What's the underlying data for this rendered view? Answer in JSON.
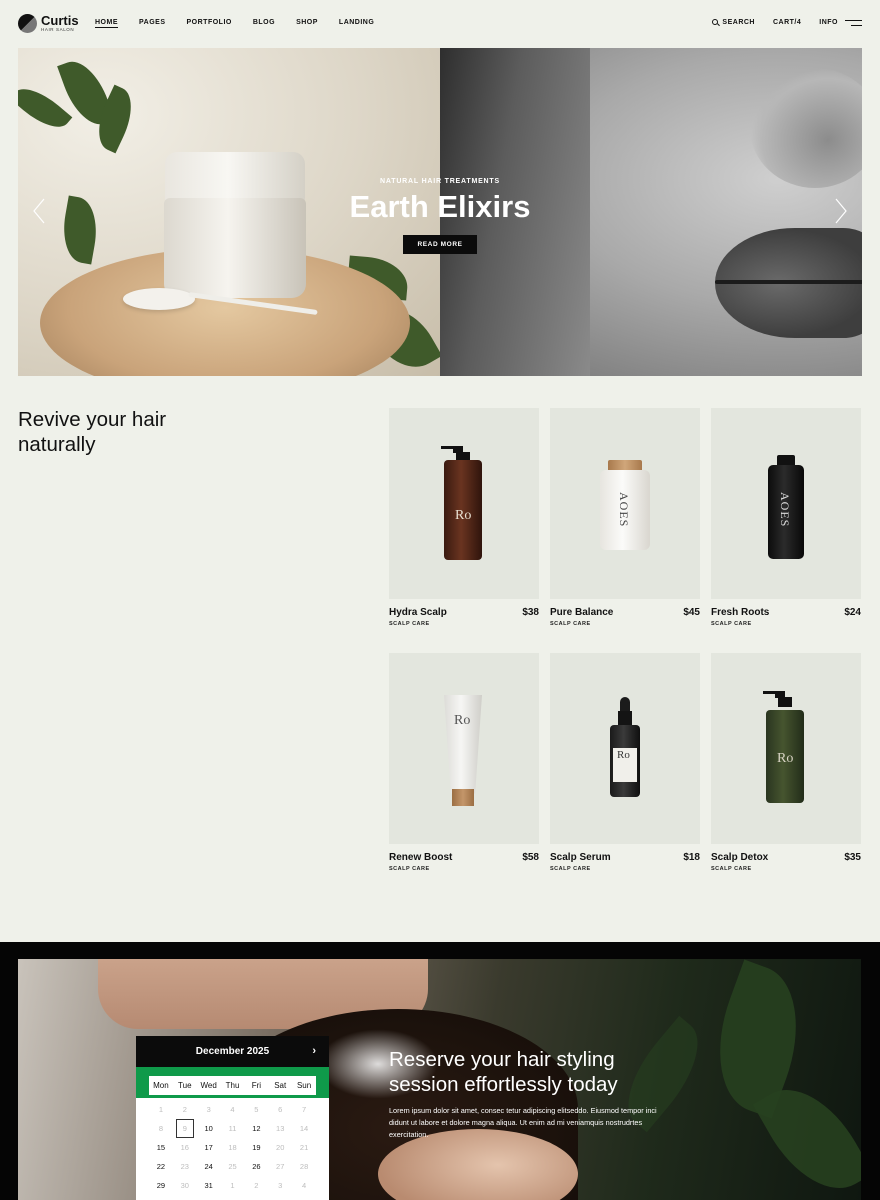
{
  "brand": {
    "name": "Curtis",
    "tagline": "HAIR SALON"
  },
  "nav": {
    "items": [
      "HOME",
      "PAGES",
      "PORTFOLIO",
      "BLOG",
      "SHOP",
      "LANDING"
    ],
    "active": "HOME",
    "search": "SEARCH",
    "cart": "CART/4",
    "info": "INFO"
  },
  "hero": {
    "kicker": "NATURAL HAIR TREATMENTS",
    "title": "Earth Elixirs",
    "button": "READ MORE"
  },
  "products": {
    "heading_line1": "Revive your hair",
    "heading_line2": "naturally",
    "items": [
      {
        "name": "Hydra Scalp",
        "price": "$38",
        "category": "SCALP CARE",
        "icon": "amber-pump-bottle"
      },
      {
        "name": "Pure Balance",
        "price": "$45",
        "category": "SCALP CARE",
        "icon": "white-cork-jar"
      },
      {
        "name": "Fresh Roots",
        "price": "$24",
        "category": "SCALP CARE",
        "icon": "black-bottle"
      },
      {
        "name": "Renew Boost",
        "price": "$58",
        "category": "SCALP CARE",
        "icon": "white-tube"
      },
      {
        "name": "Scalp Serum",
        "price": "$18",
        "category": "SCALP CARE",
        "icon": "dropper-bottle"
      },
      {
        "name": "Scalp Detox",
        "price": "$35",
        "category": "SCALP CARE",
        "icon": "green-pump-bottle"
      }
    ],
    "label_ro": "Ro",
    "label_aoes": "AOES"
  },
  "booking": {
    "title_line1": "Reserve your hair styling",
    "title_line2": "session effortlessly today",
    "body": "Lorem ipsum dolor sit amet, consec tetur adipiscing elitseddo. Eiusmod tempor inci didunt ut labore et dolore magna aliqua. Ut enim ad mi veniamquis nostrudrtes exercitation.",
    "calendar": {
      "month": "December 2025",
      "next": "›",
      "weekdays": [
        "Mon",
        "Tue",
        "Wed",
        "Thu",
        "Fri",
        "Sat",
        "Sun"
      ],
      "weeks": [
        [
          "1",
          "2",
          "3",
          "4",
          "5",
          "6",
          "7"
        ],
        [
          "8",
          "9",
          "10",
          "11",
          "12",
          "13",
          "14"
        ],
        [
          "15",
          "16",
          "17",
          "18",
          "19",
          "20",
          "21"
        ],
        [
          "22",
          "23",
          "24",
          "25",
          "26",
          "27",
          "28"
        ],
        [
          "29",
          "30",
          "31",
          "1",
          "2",
          "3",
          "4"
        ]
      ],
      "selected": "9",
      "available": [
        "10",
        "12",
        "15",
        "17",
        "19",
        "22",
        "24",
        "26",
        "29",
        "31"
      ]
    }
  },
  "colors": {
    "page_bg": "#eff1ea",
    "card_bg": "#e3e6de",
    "calendar_accent": "#0f9a4a",
    "dark": "#0b0b0b"
  }
}
